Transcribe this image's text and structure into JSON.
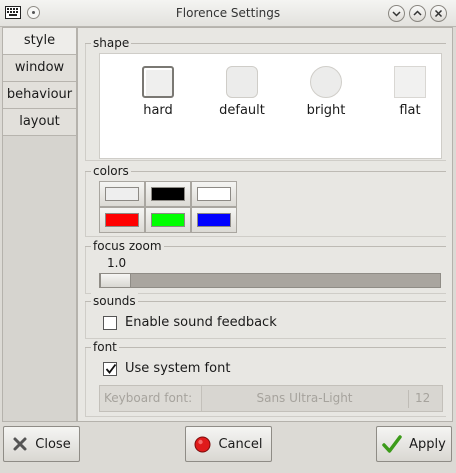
{
  "window": {
    "title": "Florence Settings"
  },
  "sidebar": {
    "tabs": [
      {
        "label": "style"
      },
      {
        "label": "window"
      },
      {
        "label": "behaviour"
      },
      {
        "label": "layout"
      }
    ],
    "active_tab": "style"
  },
  "shape": {
    "legend": "shape",
    "options": [
      {
        "label": "hard"
      },
      {
        "label": "default"
      },
      {
        "label": "bright"
      },
      {
        "label": "flat"
      }
    ]
  },
  "colors": {
    "legend": "colors",
    "swatches": [
      "#eeeeee",
      "#000000",
      "#ffffff",
      "#ff0000",
      "#00ff00",
      "#0000ff"
    ]
  },
  "focus_zoom": {
    "legend": "focus zoom",
    "value": "1.0"
  },
  "sounds": {
    "legend": "sounds",
    "enable_label": "Enable sound feedback",
    "enabled": false
  },
  "font": {
    "legend": "font",
    "use_system_label": "Use system font",
    "use_system": true,
    "keyboard_font_label": "Keyboard font:",
    "font_name": "Sans Ultra-Light",
    "font_size": "12"
  },
  "buttons": {
    "close": "Close",
    "cancel": "Cancel",
    "apply": "Apply"
  }
}
